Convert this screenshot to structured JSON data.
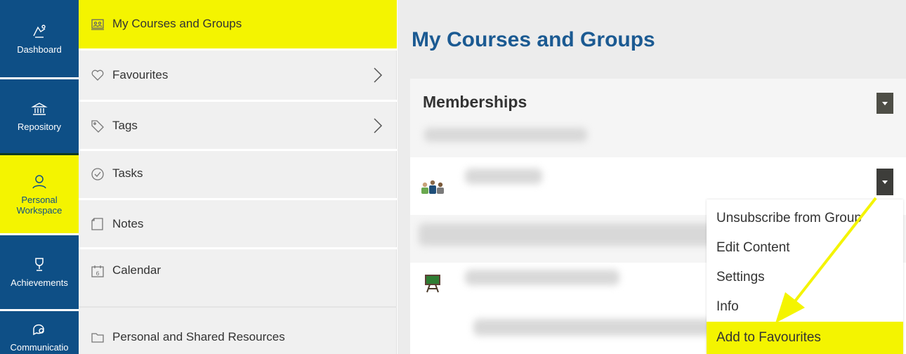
{
  "rail": {
    "items": [
      {
        "label": "Dashboard",
        "icon": "dashboard-icon"
      },
      {
        "label": "Repository",
        "icon": "repository-icon"
      },
      {
        "label": "Personal\nWorkspace",
        "label_line1": "Personal",
        "label_line2": "Workspace",
        "icon": "person-icon",
        "active": true
      },
      {
        "label": "Achievements",
        "icon": "trophy-icon"
      },
      {
        "label": "Communicatio",
        "icon": "chat-icon"
      }
    ]
  },
  "panel": {
    "items": [
      {
        "label": "My Courses and Groups",
        "icon": "courses-icon",
        "active": true
      },
      {
        "label": "Favourites",
        "icon": "heart-icon",
        "has_submenu": true
      },
      {
        "label": "Tags",
        "icon": "tag-icon",
        "has_submenu": true
      },
      {
        "label": "Tasks",
        "icon": "check-circle-icon"
      },
      {
        "label": "Notes",
        "icon": "note-icon"
      },
      {
        "label": "Calendar",
        "icon": "calendar-icon"
      },
      {
        "label": "Personal and Shared Resources",
        "icon": "folder-icon"
      }
    ]
  },
  "main": {
    "title": "My Courses and Groups",
    "card_title": "Memberships"
  },
  "dropdown": {
    "items": [
      {
        "label": "Unsubscribe from Group"
      },
      {
        "label": "Edit Content"
      },
      {
        "label": "Settings"
      },
      {
        "label": "Info"
      },
      {
        "label": "Add to Favourites",
        "highlighted": true
      }
    ]
  },
  "colors": {
    "rail_bg": "#0e4f86",
    "highlight": "#f4f400",
    "title": "#1b5a92"
  }
}
